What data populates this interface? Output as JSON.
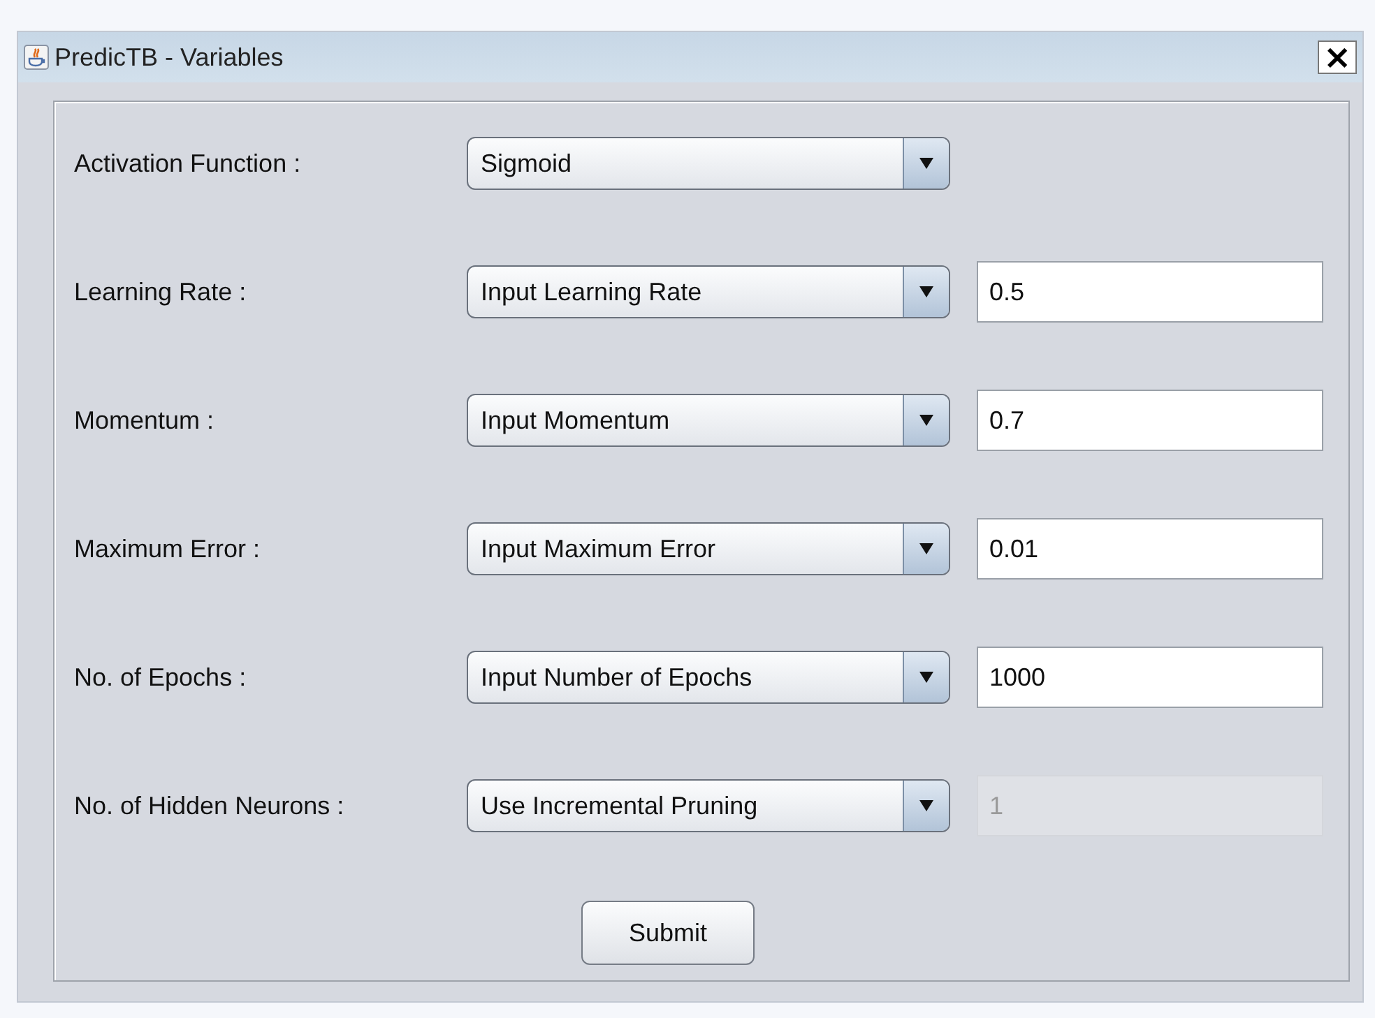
{
  "window": {
    "title": "PredicTB - Variables",
    "close": "×"
  },
  "rows": [
    {
      "label": "Activation Function :",
      "combo": "Sigmoid"
    },
    {
      "label": "Learning Rate :",
      "combo": "Input Learning Rate",
      "field": {
        "value": "0.5",
        "disabled": false
      }
    },
    {
      "label": "Momentum :",
      "combo": "Input Momentum",
      "field": {
        "value": "0.7",
        "disabled": false
      }
    },
    {
      "label": "Maximum Error :",
      "combo": "Input Maximum Error",
      "field": {
        "value": "0.01",
        "disabled": false
      }
    },
    {
      "label": "No. of Epochs :",
      "combo": "Input Number of Epochs",
      "field": {
        "value": "1000",
        "disabled": false
      }
    },
    {
      "label": "No. of Hidden Neurons :",
      "combo": "Use Incremental Pruning",
      "field": {
        "value": "1",
        "disabled": true
      }
    }
  ],
  "submit": "Submit"
}
